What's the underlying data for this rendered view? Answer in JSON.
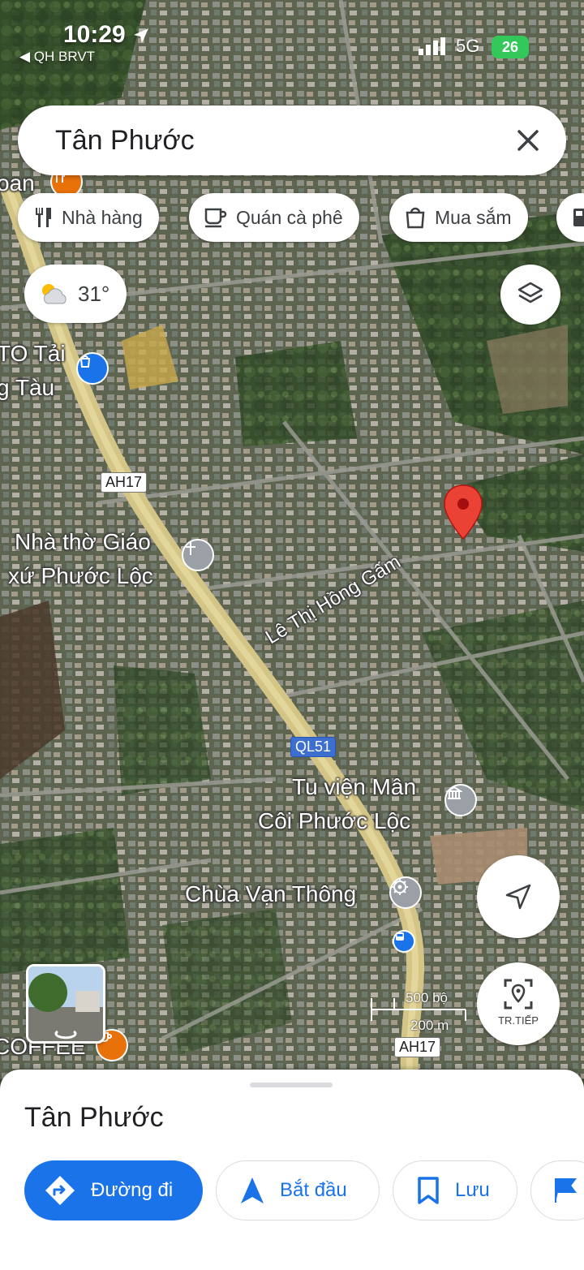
{
  "status_bar": {
    "time": "10:29",
    "back_label": "◀ QH BRVT",
    "network": "5G",
    "battery": "26"
  },
  "search": {
    "query": "Tân Phước"
  },
  "chips": [
    {
      "label": "Nhà hàng",
      "icon": "fork-knife-icon"
    },
    {
      "label": "Quán cà phê",
      "icon": "coffee-cup-icon"
    },
    {
      "label": "Mua sắm",
      "icon": "shopping-bag-icon"
    }
  ],
  "weather": {
    "temperature": "31°",
    "icon": "partly-cloudy-icon"
  },
  "map": {
    "labels": {
      "partial_top": "oan",
      "poi_auto": "TO Tải",
      "poi_auto_2": "g Tàu",
      "church_1": "Nhà thờ Giáo",
      "church_2": "xứ Phước Lộc",
      "street": "Lê Thị Hồng Gấm",
      "monastery_1": "Tu viện Mân",
      "monastery_2": "Côi Phước Lộc",
      "pagoda": "Chùa Vạn Thông",
      "coffee": "COFFEE"
    },
    "road_shields": {
      "ah17_top": "AH17",
      "ql51": "QL51",
      "ah17_bottom": "AH17"
    },
    "scale": {
      "imperial": "500 bộ",
      "metric": "200 m"
    },
    "live_view_label": "TR.TIẾP"
  },
  "sheet": {
    "title": "Tân Phước",
    "actions": [
      {
        "label": "Đường đi",
        "icon": "directions-icon"
      },
      {
        "label": "Bắt đầu",
        "icon": "navigation-arrow-icon"
      },
      {
        "label": "Lưu",
        "icon": "bookmark-icon"
      }
    ]
  },
  "colors": {
    "accent": "#1a73e8",
    "pin": "#ea4335",
    "highway": "#d4c587"
  }
}
